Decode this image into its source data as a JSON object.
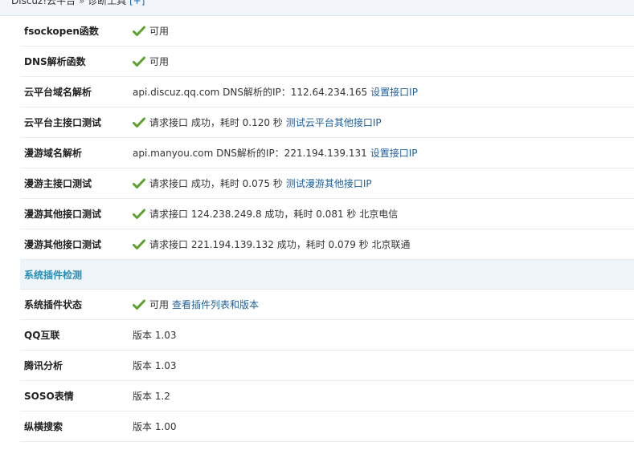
{
  "breadcrumb": {
    "root": "Discuz!云平台",
    "separator": "»",
    "current": "诊断工具",
    "toggle": "[+]"
  },
  "rows_top": [
    {
      "label": "fsockopen函数",
      "check": true,
      "text": "可用",
      "link": ""
    },
    {
      "label": "DNS解析函数",
      "check": true,
      "text": "可用",
      "link": ""
    },
    {
      "label": "云平台域名解析",
      "check": false,
      "text": "api.discuz.qq.com DNS解析的IP：112.64.234.165",
      "link": "设置接口IP"
    },
    {
      "label": "云平台主接口测试",
      "check": true,
      "text": "请求接口 成功，耗时 0.120 秒",
      "link": "测试云平台其他接口IP"
    },
    {
      "label": "漫游域名解析",
      "check": false,
      "text": "api.manyou.com DNS解析的IP：221.194.139.131",
      "link": "设置接口IP"
    },
    {
      "label": "漫游主接口测试",
      "check": true,
      "text": "请求接口 成功，耗时 0.075 秒",
      "link": "测试漫游其他接口IP"
    },
    {
      "label": "漫游其他接口测试",
      "check": true,
      "text": "请求接口 124.238.249.8 成功，耗时 0.081 秒 北京电信",
      "link": ""
    },
    {
      "label": "漫游其他接口测试",
      "check": true,
      "text": "请求接口 221.194.139.132 成功，耗时 0.079 秒 北京联通",
      "link": ""
    }
  ],
  "section": {
    "title": "系统插件检测"
  },
  "rows_bottom": [
    {
      "label": "系统插件状态",
      "check": true,
      "text": "可用",
      "link": "查看插件列表和版本"
    },
    {
      "label": "QQ互联",
      "check": false,
      "text": "版本 1.03",
      "link": ""
    },
    {
      "label": "腾讯分析",
      "check": false,
      "text": "版本 1.03",
      "link": ""
    },
    {
      "label": "SOSO表情",
      "check": false,
      "text": "版本 1.2",
      "link": ""
    },
    {
      "label": "纵横搜索",
      "check": false,
      "text": "版本 1.00",
      "link": ""
    }
  ],
  "colors": {
    "check": "#5aa12e",
    "link": "#1f5f9e",
    "section": "#2b8fb5"
  },
  "icons": {
    "check": "checkmark-icon"
  }
}
